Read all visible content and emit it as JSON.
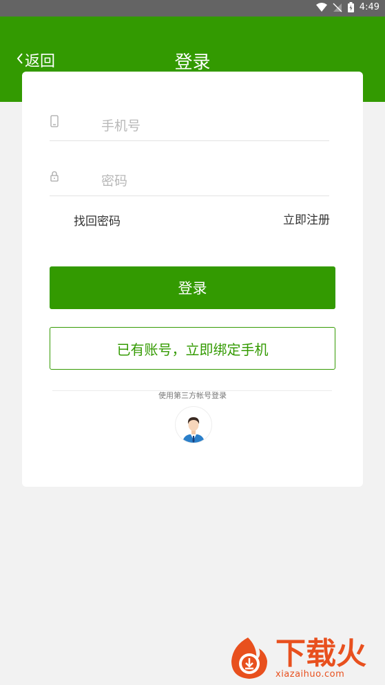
{
  "status_bar": {
    "time": "4:49"
  },
  "header": {
    "back_label": "返回",
    "title": "登录"
  },
  "form": {
    "phone_placeholder": "手机号",
    "password_placeholder": "密码",
    "forgot_label": "找回密码",
    "register_label": "立即注册",
    "login_button": "登录",
    "bind_button": "已有账号，立即绑定手机"
  },
  "third_party": {
    "label": "使用第三方帐号登录"
  },
  "watermark": {
    "main": "下载火",
    "sub": "xiazaihuo.com"
  },
  "colors": {
    "brand": "#339a01",
    "watermark": "#e8501e"
  }
}
